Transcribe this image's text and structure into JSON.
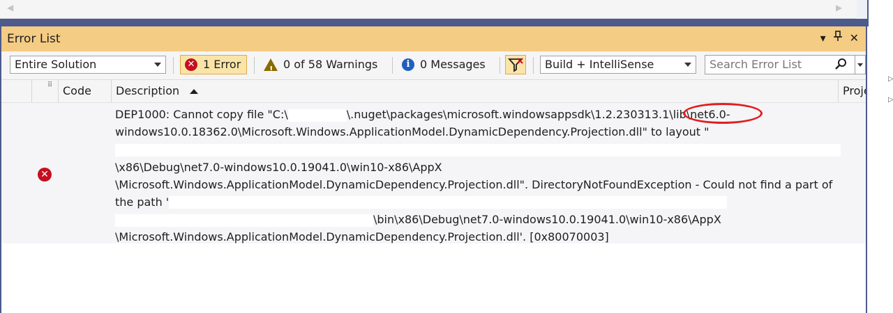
{
  "panel": {
    "title": "Error List"
  },
  "toolbar": {
    "scope": "Entire Solution",
    "errors": "1 Error",
    "warnings": "0 of 58 Warnings",
    "messages": "0 Messages",
    "build_filter": "Build + IntelliSense",
    "search_placeholder": "Search Error List"
  },
  "columns": {
    "code": "Code",
    "description": "Description",
    "project": "Proje"
  },
  "error_row": {
    "lines": [
      "DEP1000: Cannot copy file \"C:\\",
      "\\.nuget\\packages\\microsoft.windowsappsdk\\1.2.230313.1\\lib\\net6.0-",
      "windows10.0.18362.0\\Microsoft.Windows.ApplicationModel.DynamicDependency.Projection.dll\" to layout \"",
      "\\x86\\Debug\\net7.0-windows10.0.19041.0\\win10-x86\\AppX",
      "\\Microsoft.Windows.ApplicationModel.DynamicDependency.Projection.dll\". DirectoryNotFoundException - Could not find a part of",
      "the path '",
      "\\bin\\x86\\Debug\\net7.0-windows10.0.19041.0\\win10-x86\\AppX",
      "\\Microsoft.Windows.ApplicationModel.DynamicDependency.Projection.dll'. [0x80070003]"
    ]
  },
  "colors": {
    "title_bar": "#f5cc84",
    "frame": "#4d5a8c",
    "error_red": "#c50f1f",
    "highlight_circle": "#e01f1f"
  }
}
